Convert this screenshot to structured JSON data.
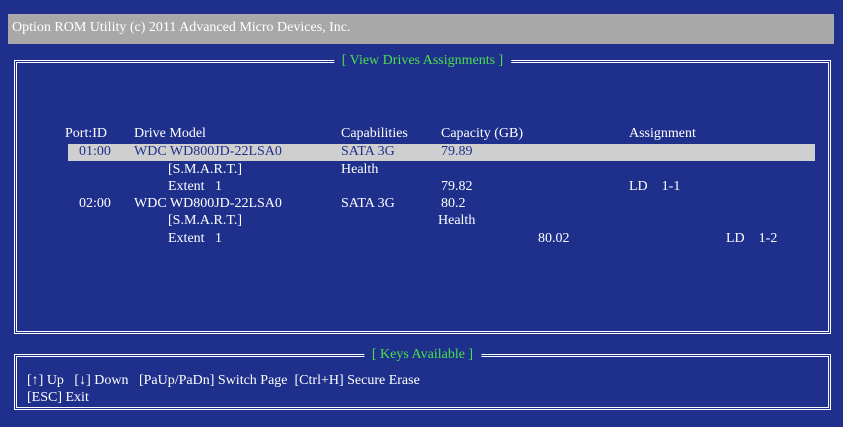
{
  "window": {
    "title": "Option ROM Utility (c) 2011 Advanced Micro Devices, Inc."
  },
  "drives_panel": {
    "title": "[ View Drives Assignments  ]",
    "headers": {
      "port_id": "Port:ID",
      "drive_model": "Drive Model",
      "capabilities": "Capabilities",
      "capacity": "Capacity (GB)",
      "assignment": "Assignment"
    },
    "rows": [
      {
        "port_id": "01:00",
        "drive_model": "WDC WD800JD-22LSA0",
        "capabilities": "SATA 3G",
        "capacity": "79.89",
        "assignment": ""
      },
      {
        "port_id": "",
        "drive_model": "[S.M.A.R.T.]",
        "capabilities": "Health",
        "capacity": "",
        "assignment": ""
      },
      {
        "port_id": "",
        "drive_model": "Extent   1",
        "capabilities": "",
        "capacity": "79.82",
        "assignment": "LD    1-1"
      },
      {
        "port_id": "02:00",
        "drive_model": "WDC WD800JD-22LSA0",
        "capabilities": "SATA 3G",
        "capacity": "80.2",
        "assignment": ""
      },
      {
        "port_id": "",
        "drive_model": "[S.M.A.R.T.]",
        "capabilities": "",
        "capacity": "Health",
        "assignment": ""
      },
      {
        "port_id": "",
        "drive_model": "Extent   1",
        "capabilities": "",
        "capacity": "80.02",
        "assignment": "LD    1-2"
      }
    ]
  },
  "keys_panel": {
    "title": "[ Keys Available ]",
    "line1": "[↑] Up   [↓] Down   [PaUp/PaDn] Switch Page  [Ctrl+H] Secure Erase",
    "line2": "[ESC] Exit"
  },
  "colors": {
    "background": "#1e2f8c",
    "accent_green": "#4ae04a",
    "highlight": "#cfcfcf",
    "titlebar": "#a8a8a8"
  }
}
